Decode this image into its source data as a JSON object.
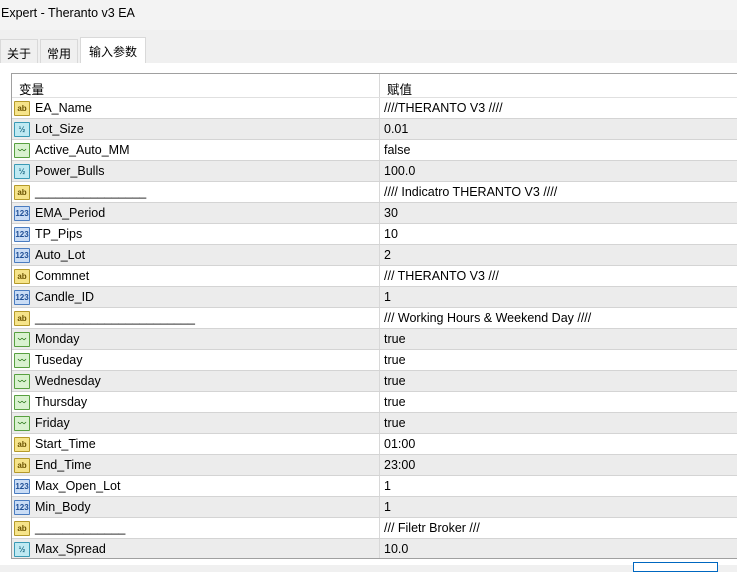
{
  "window": {
    "title": "Expert - Theranto v3 EA"
  },
  "tabs": [
    {
      "label": "关于"
    },
    {
      "label": "常用"
    },
    {
      "label": "输入参数"
    }
  ],
  "table": {
    "headers": {
      "variable": "变量",
      "value": "赋值"
    },
    "rows": [
      {
        "type": "string",
        "icon": "ab",
        "name": "EA_Name",
        "value": "////THERANTO V3 ////"
      },
      {
        "type": "double",
        "icon": "½",
        "name": "Lot_Size",
        "value": "0.01"
      },
      {
        "type": "bool",
        "icon": "〰",
        "name": "Active_Auto_MM",
        "value": "false"
      },
      {
        "type": "double",
        "icon": "½",
        "name": "Power_Bulls",
        "value": "100.0"
      },
      {
        "type": "string",
        "icon": "ab",
        "name": "________________",
        "value": "//// Indicatro THERANTO V3  ////"
      },
      {
        "type": "int",
        "icon": "123",
        "name": "EMA_Period",
        "value": "30"
      },
      {
        "type": "int",
        "icon": "123",
        "name": "TP_Pips",
        "value": "10"
      },
      {
        "type": "int",
        "icon": "123",
        "name": "Auto_Lot",
        "value": "2"
      },
      {
        "type": "string",
        "icon": "ab",
        "name": "Commnet",
        "value": "/// THERANTO V3 ///"
      },
      {
        "type": "int",
        "icon": "123",
        "name": "Candle_ID",
        "value": "1"
      },
      {
        "type": "string",
        "icon": "ab",
        "name": "_______________________",
        "value": "/// Working Hours & Weekend Day ////"
      },
      {
        "type": "bool",
        "icon": "〰",
        "name": "Monday",
        "value": "true"
      },
      {
        "type": "bool",
        "icon": "〰",
        "name": "Tuseday",
        "value": "true"
      },
      {
        "type": "bool",
        "icon": "〰",
        "name": "Wednesday",
        "value": "true"
      },
      {
        "type": "bool",
        "icon": "〰",
        "name": "Thursday",
        "value": "true"
      },
      {
        "type": "bool",
        "icon": "〰",
        "name": "Friday",
        "value": "true"
      },
      {
        "type": "string",
        "icon": "ab",
        "name": "Start_Time",
        "value": "01:00"
      },
      {
        "type": "string",
        "icon": "ab",
        "name": "End_Time",
        "value": "23:00"
      },
      {
        "type": "int",
        "icon": "123",
        "name": "Max_Open_Lot",
        "value": "1"
      },
      {
        "type": "int",
        "icon": "123",
        "name": "Min_Body",
        "value": "1"
      },
      {
        "type": "string",
        "icon": "ab",
        "name": "_____________",
        "value": "/// Filetr Broker ///"
      },
      {
        "type": "double",
        "icon": "½",
        "name": "Max_Spread",
        "value": "10.0"
      }
    ]
  }
}
